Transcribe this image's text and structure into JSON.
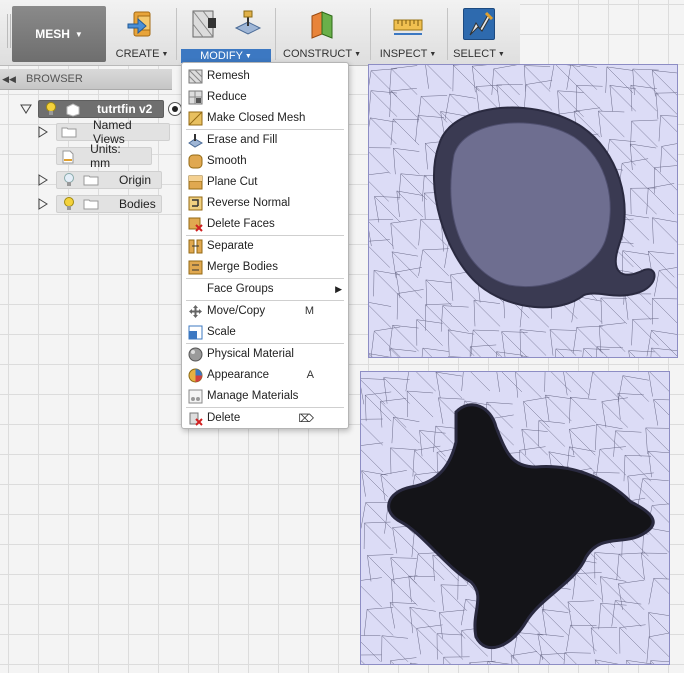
{
  "toolbar": {
    "workspace_label": "MESH",
    "groups": [
      {
        "label": "CREATE"
      },
      {
        "label": "MODIFY"
      },
      {
        "label": "CONSTRUCT"
      },
      {
        "label": "INSPECT"
      },
      {
        "label": "SELECT"
      }
    ]
  },
  "browser": {
    "title": "BROWSER",
    "root": {
      "label": "tutrtfin v2"
    },
    "items": [
      {
        "label": "Named Views"
      },
      {
        "label": "Units: mm"
      },
      {
        "label": "Origin"
      },
      {
        "label": "Bodies"
      }
    ]
  },
  "menu": {
    "items": [
      {
        "label": "Remesh",
        "shortcut": ""
      },
      {
        "label": "Reduce",
        "shortcut": ""
      },
      {
        "label": "Make Closed Mesh",
        "shortcut": ""
      },
      {
        "label": "Erase and Fill",
        "shortcut": ""
      },
      {
        "label": "Smooth",
        "shortcut": ""
      },
      {
        "label": "Plane Cut",
        "shortcut": ""
      },
      {
        "label": "Reverse Normal",
        "shortcut": ""
      },
      {
        "label": "Delete Faces",
        "shortcut": ""
      },
      {
        "label": "Separate",
        "shortcut": ""
      },
      {
        "label": "Merge Bodies",
        "shortcut": ""
      },
      {
        "label": "Face Groups",
        "shortcut": ""
      },
      {
        "label": "Move/Copy",
        "shortcut": "M"
      },
      {
        "label": "Scale",
        "shortcut": ""
      },
      {
        "label": "Physical Material",
        "shortcut": ""
      },
      {
        "label": "Appearance",
        "shortcut": "A"
      },
      {
        "label": "Manage Materials",
        "shortcut": ""
      },
      {
        "label": "Delete",
        "shortcut": "⌦"
      }
    ]
  },
  "colors": {
    "toolbar_active": "#3c78c2",
    "mesh_fill": "#dcdcf6",
    "mesh_dark": "#141418"
  }
}
